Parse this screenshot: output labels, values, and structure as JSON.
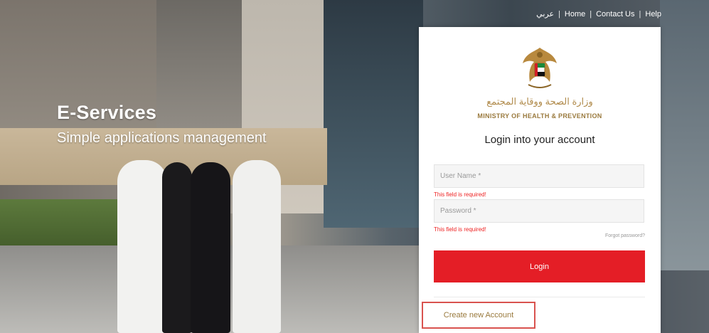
{
  "topnav": {
    "arabic": "عربي",
    "home": "Home",
    "contact": "Contact Us",
    "help": "Help"
  },
  "hero": {
    "title": "E-Services",
    "subtitle": "Simple applications management"
  },
  "card": {
    "ministry_ar": "وزارة الصحة ووقاية المجتمع",
    "ministry_en": "MINISTRY OF HEALTH & PREVENTION",
    "title": "Login into your account",
    "username_placeholder": "User Name *",
    "username_error": "This field is required!",
    "password_placeholder": "Password *",
    "password_error": "This field is required!",
    "forgot": "Forgot password?",
    "login_label": "Login",
    "create_account": "Create new Account"
  },
  "colors": {
    "accent": "#e41e26",
    "gold": "#9a7a3e",
    "error": "#e22222"
  }
}
